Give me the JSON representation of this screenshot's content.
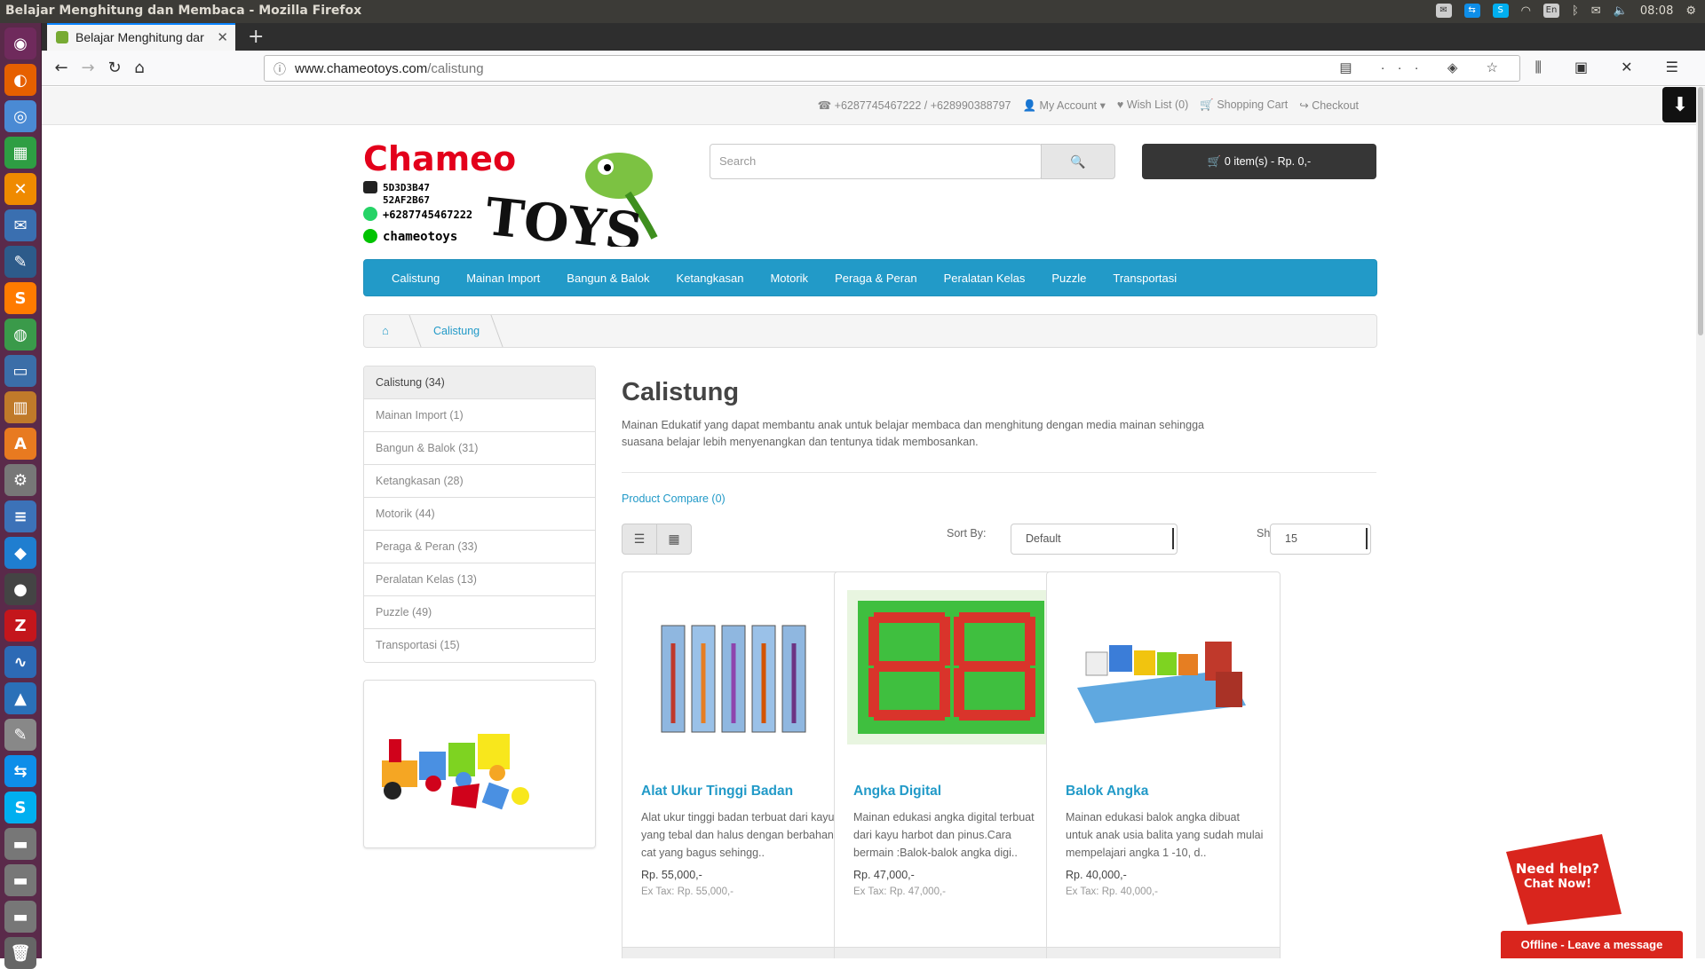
{
  "os": {
    "window_title": "Belajar Menghitung dan Membaca - Mozilla Firefox",
    "clock": "08:08",
    "keyboard_layout": "En"
  },
  "browser": {
    "tab_title": "Belajar Menghitung dar",
    "url_host": "www.chameotoys.com",
    "url_path": "/calistung"
  },
  "header": {
    "phone": "+6287745467222 / +628990388797",
    "my_account": "My Account",
    "wish_list": "Wish List (0)",
    "shopping_cart": "Shopping Cart",
    "checkout": "Checkout",
    "search_placeholder": "Search",
    "cart_summary": "0 item(s) - Rp. 0,-"
  },
  "logo": {
    "brand_top": "Chameo",
    "brand_bottom": "TOYS",
    "bbm_pin_1": "5D3D3B47",
    "bbm_pin_2": "52AF2B67",
    "whatsapp": "+6287745467222",
    "line_id": "chameotoys"
  },
  "menu": [
    "Calistung",
    "Mainan Import",
    "Bangun & Balok",
    "Ketangkasan",
    "Motorik",
    "Peraga & Peran",
    "Peralatan Kelas",
    "Puzzle",
    "Transportasi"
  ],
  "breadcrumb": {
    "current": "Calistung"
  },
  "sidebar": [
    "Calistung (34)",
    "Mainan Import (1)",
    "Bangun & Balok (31)",
    "Ketangkasan (28)",
    "Motorik (44)",
    "Peraga & Peran (33)",
    "Peralatan Kelas (13)",
    "Puzzle (49)",
    "Transportasi (15)"
  ],
  "category": {
    "title": "Calistung",
    "description": "Mainan Edukatif yang dapat membantu anak untuk belajar membaca dan menghitung dengan media mainan sehingga suasana belajar lebih menyenangkan dan tentunya tidak membosankan.",
    "compare": "Product Compare (0)",
    "sort_label": "Sort By:",
    "sort_value": "Default",
    "show_label": "Show:",
    "show_value": "15"
  },
  "products": [
    {
      "name": "Alat Ukur Tinggi Badan",
      "desc": "Alat ukur tinggi badan terbuat dari kayu yang tebal dan halus dengan berbahan cat yang bagus sehingg..",
      "price": "Rp. 55,000,-",
      "tax": "Ex Tax: Rp. 55,000,-"
    },
    {
      "name": "Angka Digital",
      "desc": "Mainan edukasi angka digital terbuat dari kayu harbot dan pinus.Cara bermain :Balok-balok angka digi..",
      "price": "Rp. 47,000,-",
      "tax": "Ex Tax: Rp. 47,000,-"
    },
    {
      "name": "Balok Angka",
      "desc": "Mainan edukasi balok angka dibuat untuk anak usia balita yang sudah mulai mempelajari angka 1 -10, d..",
      "price": "Rp. 40,000,-",
      "tax": "Ex Tax: Rp. 40,000,-"
    }
  ],
  "chat": {
    "need_help": "Need help?",
    "chat_now": "Chat Now!",
    "offline": "Offline - Leave a message"
  },
  "colors": {
    "accent": "#229ac8",
    "cart_bg": "#363636",
    "launcher": "#5a2a4a",
    "offline_red": "#d9251d"
  }
}
